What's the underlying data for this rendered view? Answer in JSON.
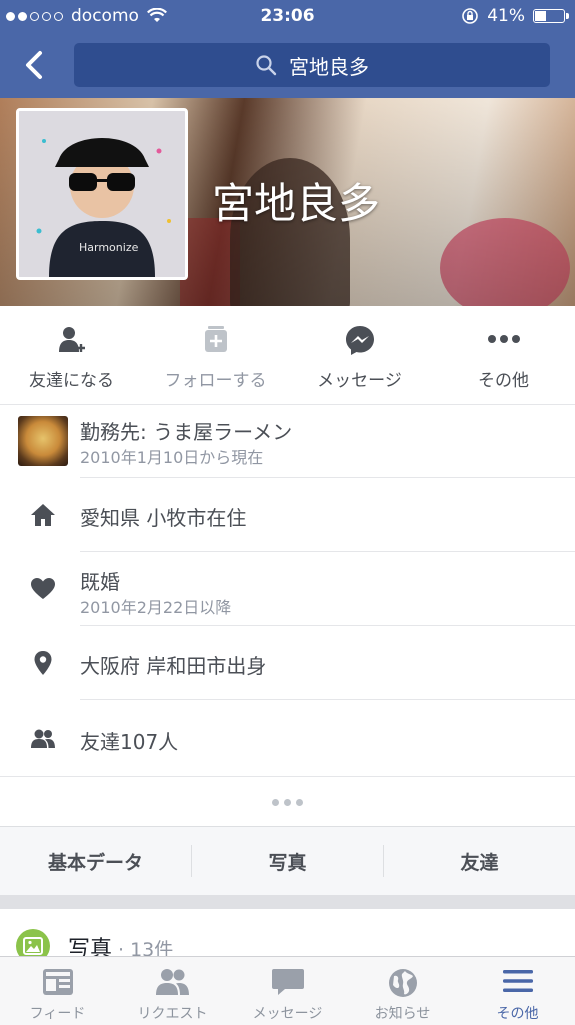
{
  "status_bar": {
    "carrier": "docomo",
    "time": "23:06",
    "battery_percent": "41%",
    "battery_level": 0.41,
    "signal_bars_filled": 2,
    "signal_bars_total": 5
  },
  "navbar": {
    "search_text": "宮地良多"
  },
  "profile": {
    "name": "宮地良多"
  },
  "actions": [
    {
      "label": "友達になる",
      "icon": "add-friend-icon",
      "enabled": true
    },
    {
      "label": "フォローする",
      "icon": "follow-icon",
      "enabled": false
    },
    {
      "label": "メッセージ",
      "icon": "messenger-icon",
      "enabled": true
    },
    {
      "label": "その他",
      "icon": "more-icon",
      "enabled": true
    }
  ],
  "info": {
    "work": {
      "main": "勤務先: うま屋ラーメン",
      "sub": "2010年1月10日から現在"
    },
    "lives": {
      "main": "愛知県 小牧市在住"
    },
    "relationship": {
      "main": "既婚",
      "sub": "2010年2月22日以降"
    },
    "hometown": {
      "main": "大阪府 岸和田市出身"
    },
    "friends": {
      "main": "友達107人"
    }
  },
  "section_tabs": [
    "基本データ",
    "写真",
    "友達"
  ],
  "photos": {
    "title": "写真",
    "count": "· 13件"
  },
  "tab_bar": [
    {
      "label": "フィード",
      "icon": "feed-icon",
      "active": false
    },
    {
      "label": "リクエスト",
      "icon": "friend-requests-icon",
      "active": false
    },
    {
      "label": "メッセージ",
      "icon": "messages-icon",
      "active": false
    },
    {
      "label": "お知らせ",
      "icon": "notifications-globe-icon",
      "active": false
    },
    {
      "label": "その他",
      "icon": "menu-icon",
      "active": true
    }
  ],
  "colors": {
    "brand": "#4a67a8",
    "active_tab": "#4a67a8",
    "inactive": "#8d949e"
  }
}
